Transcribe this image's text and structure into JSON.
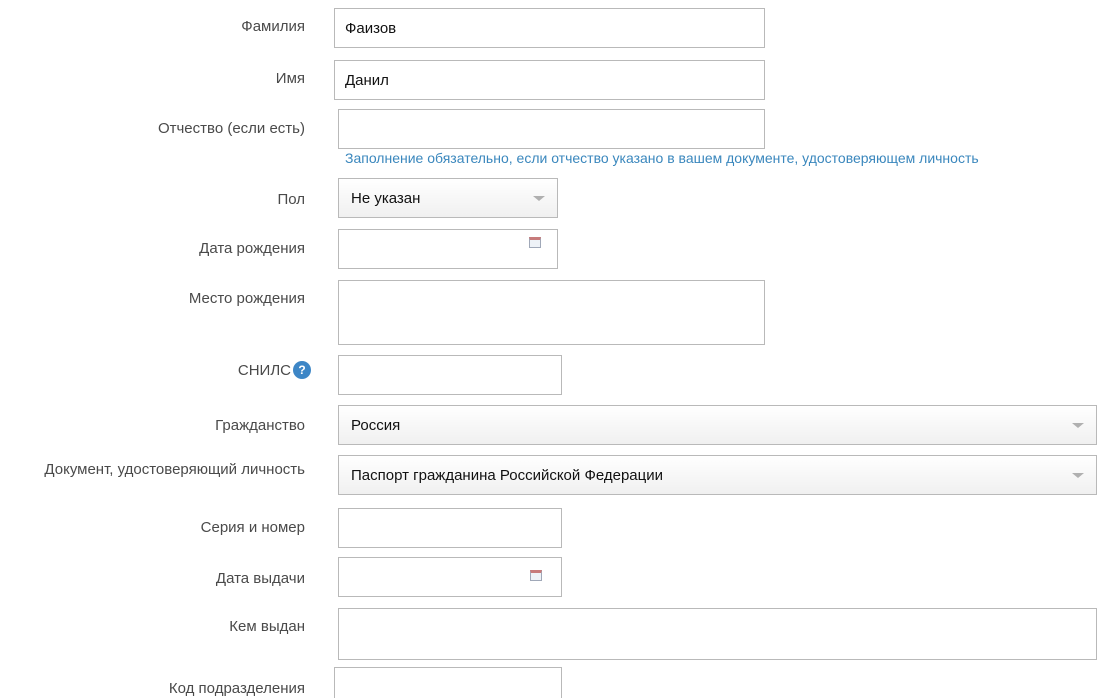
{
  "form": {
    "surname": {
      "label": "Фамилия",
      "value": "Фаизов"
    },
    "name": {
      "label": "Имя",
      "value": "Данил"
    },
    "patronymic": {
      "label": "Отчество (если есть)",
      "value": "",
      "hint": "Заполнение обязательно, если отчество указано в вашем документе, удостоверяющем личность"
    },
    "gender": {
      "label": "Пол",
      "value": "Не указан"
    },
    "birth_date": {
      "label": "Дата рождения",
      "value": ""
    },
    "birth_place": {
      "label": "Место рождения",
      "value": ""
    },
    "snils": {
      "label": "СНИЛС",
      "value": "",
      "help_glyph": "?"
    },
    "citizenship": {
      "label": "Гражданство",
      "value": "Россия"
    },
    "id_document": {
      "label": "Документ, удостоверяющий личность",
      "value": "Паспорт гражданина Российской Федерации"
    },
    "series_number": {
      "label": "Серия и номер",
      "value": ""
    },
    "issue_date": {
      "label": "Дата выдачи",
      "value": ""
    },
    "issued_by": {
      "label": "Кем выдан",
      "value": ""
    },
    "department_code": {
      "label": "Код подразделения",
      "value": ""
    }
  },
  "icons": {
    "calendar": "calendar-icon",
    "help": "help-icon",
    "dropdown": "chevron-down-icon"
  },
  "colors": {
    "label_text": "#4a4a4a",
    "hint_text": "#3a87bd",
    "help_badge": "#3d86c6",
    "border": "#b9b9b9"
  }
}
